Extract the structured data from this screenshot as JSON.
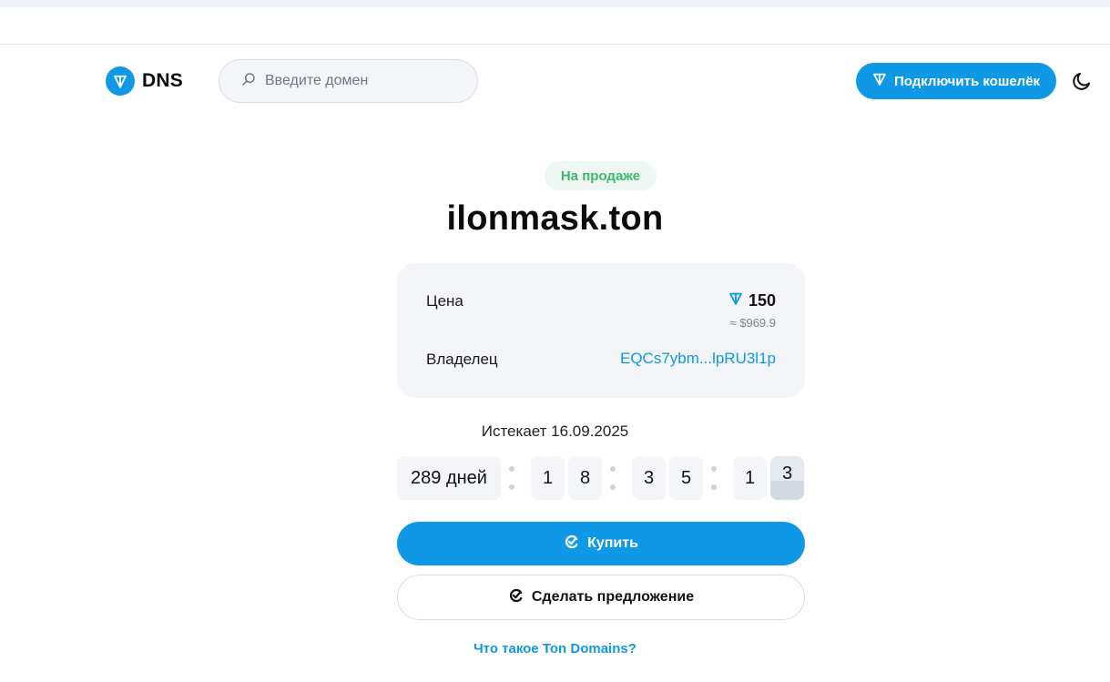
{
  "header": {
    "logo_text": "DNS",
    "search_placeholder": "Введите домен",
    "connect_wallet_label": "Подключить кошелёк"
  },
  "domain": {
    "status_badge": "На продаже",
    "name": "ilonmask.ton"
  },
  "details": {
    "price_label": "Цена",
    "price_value": "150",
    "price_usd": "≈ $969.9",
    "owner_label": "Владелец",
    "owner_address": "EQCs7ybm...lpRU3l1p"
  },
  "expiry": {
    "text": "Истекает 16.09.2025",
    "days": "289 дней",
    "digits": [
      "1",
      "8",
      "3",
      "5",
      "1",
      "3"
    ]
  },
  "actions": {
    "buy_label": "Купить",
    "offer_label": "Сделать предложение",
    "what_is_link": "Что такое Ton Domains?"
  },
  "colors": {
    "accent": "#0e98e6",
    "badge_green": "#3cb86d",
    "card_bg": "#f3f5f8"
  }
}
